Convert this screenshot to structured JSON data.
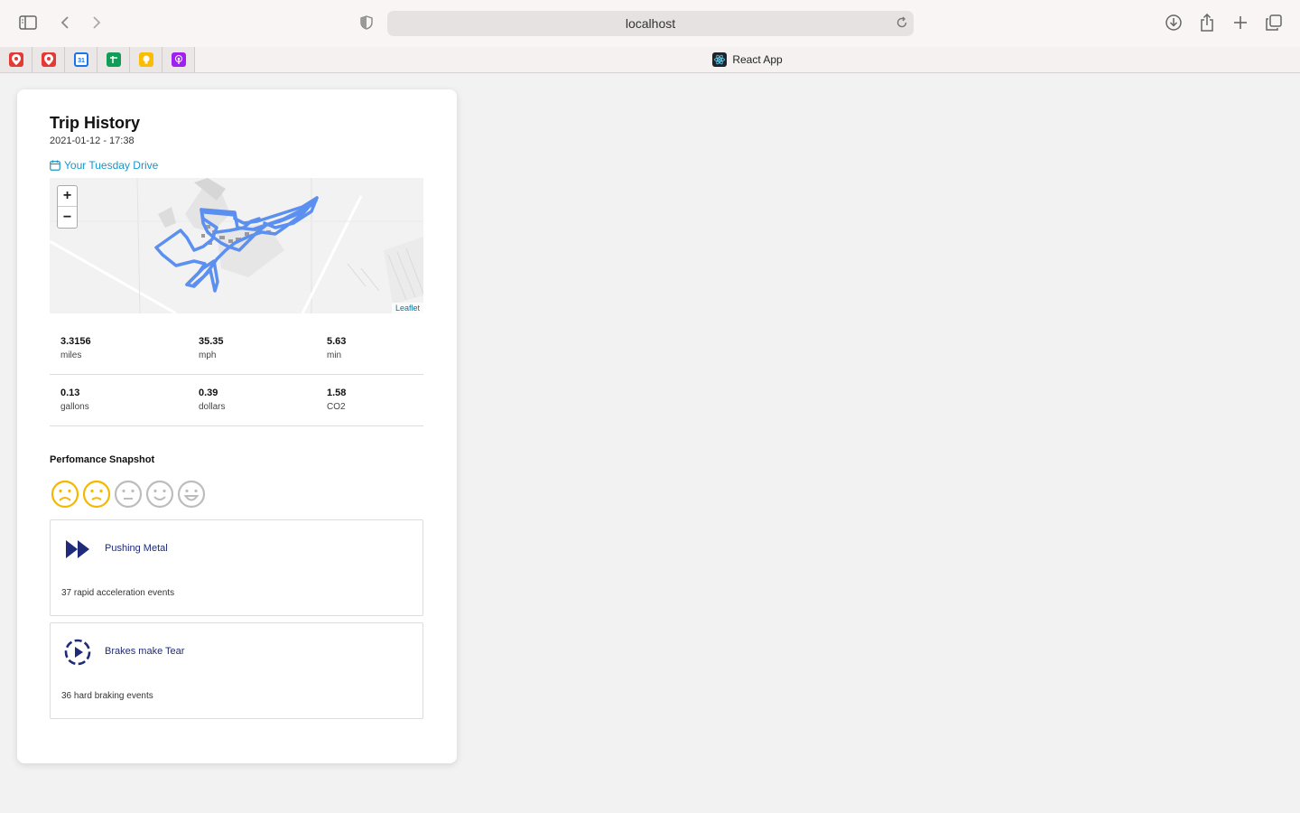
{
  "browser": {
    "address": "localhost",
    "active_tab": "React App",
    "pinned_tabs": [
      {
        "name": "maps-pin-tab",
        "color": "#e53935"
      },
      {
        "name": "maps-pin-tab-2",
        "color": "#e53935"
      },
      {
        "name": "calendar-tab",
        "color": "#1a73e8"
      },
      {
        "name": "sheets-tab",
        "color": "#0f9d58"
      },
      {
        "name": "keep-tab",
        "color": "#fbbc04"
      },
      {
        "name": "podcasts-tab",
        "color": "#a020f0"
      }
    ]
  },
  "trip": {
    "title": "Trip History",
    "datetime": "2021-01-12 - 17:38",
    "drive_label": "Your Tuesday Drive",
    "map": {
      "zoom_in": "+",
      "zoom_out": "−",
      "attribution": "Leaflet"
    },
    "stats": [
      {
        "value": "3.3156",
        "unit": "miles"
      },
      {
        "value": "35.35",
        "unit": "mph"
      },
      {
        "value": "5.63",
        "unit": "min"
      },
      {
        "value": "0.13",
        "unit": "gallons"
      },
      {
        "value": "0.39",
        "unit": "dollars"
      },
      {
        "value": "1.58",
        "unit": "CO2"
      }
    ],
    "snapshot_title": "Perfomance Snapshot",
    "rating": {
      "value": 2,
      "max": 5,
      "active_color": "#f5b800",
      "inactive_color": "#bdbdbd"
    },
    "events": [
      {
        "title": "Pushing Metal",
        "description": "37 rapid acceleration events",
        "icon": "fast-forward-icon"
      },
      {
        "title": "Brakes make Tear",
        "description": "36 hard braking events",
        "icon": "play-circle-dashed-icon"
      }
    ],
    "colors": {
      "route": "#5b8ff0",
      "link": "#1996c8",
      "event_icon": "#1f2a7a"
    }
  }
}
